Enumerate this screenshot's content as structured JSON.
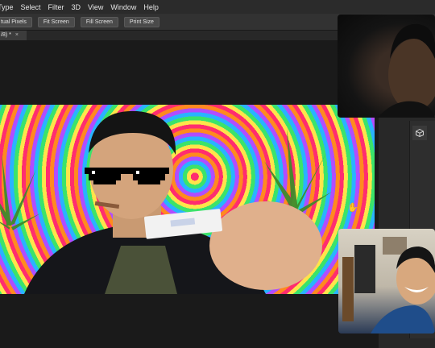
{
  "menu": [
    "Type",
    "Select",
    "Filter",
    "3D",
    "View",
    "Window",
    "Help"
  ],
  "options": [
    "tual Pixels",
    "Fit Screen",
    "Fill Screen",
    "Print Size"
  ],
  "tab": {
    "label": "/8) *",
    "close": "×"
  },
  "icons": {
    "cube": "cube-icon",
    "cursor": "hand-cursor-icon"
  },
  "colors": {
    "menubar": "#2b2b2b",
    "optbar": "#323232",
    "canvas": "#1a1a1a",
    "panel": "#282828"
  }
}
